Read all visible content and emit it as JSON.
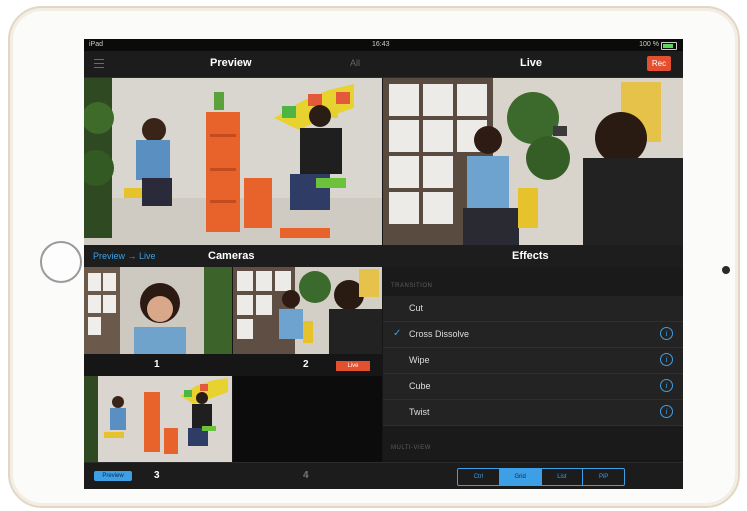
{
  "status": {
    "carrier": "iPad",
    "time": "16:43",
    "battery": "100 %"
  },
  "nav": {
    "preview_title": "Preview",
    "all_label": "All",
    "live_title": "Live",
    "rec_label": "Rec"
  },
  "section": {
    "preview_to_live": "Preview → Live",
    "cameras_title": "Cameras",
    "effects_title": "Effects"
  },
  "cameras": [
    {
      "label": "1"
    },
    {
      "label": "2",
      "badge": "Live"
    },
    {
      "label": "3"
    },
    {
      "label": "4"
    }
  ],
  "effects": {
    "transition_header": "TRANSITION",
    "items": [
      {
        "label": "Cut",
        "selected": false,
        "info": false
      },
      {
        "label": "Cross Dissolve",
        "selected": true,
        "info": true
      },
      {
        "label": "Wipe",
        "selected": false,
        "info": true
      },
      {
        "label": "Cube",
        "selected": false,
        "info": true
      },
      {
        "label": "Twist",
        "selected": false,
        "info": true
      }
    ],
    "multiview_header": "MULTI-VIEW",
    "check_glyph": "✓",
    "info_glyph": "i"
  },
  "bottom": {
    "preview_badge": "Preview",
    "segments": [
      "Ctrl",
      "Grid",
      "List",
      "PiP"
    ],
    "active_segment": 1
  },
  "colors": {
    "accent": "#3da0e6",
    "rec": "#e2502f",
    "screen_bg": "#161616"
  }
}
